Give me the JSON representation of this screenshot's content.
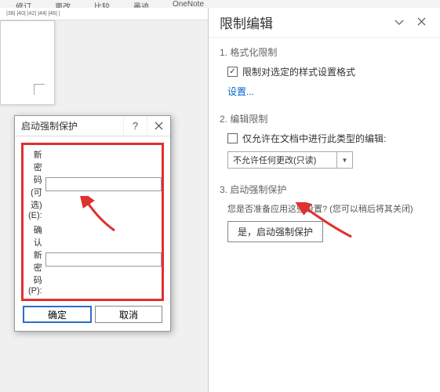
{
  "top_tabs": {
    "t1": "修订",
    "t2": "更改",
    "t3": "比较",
    "t4": "墨迹",
    "t5": "OneNote"
  },
  "ruler": {
    "marks": "|38|   |40|  |42|  |44|  |46|  |"
  },
  "dialog": {
    "title": "启动强制保护",
    "help": "?",
    "pwd1_label": "新密码(可选)(E):",
    "pwd2_label": "确认新密码(P):",
    "ok": "确定",
    "cancel": "取消"
  },
  "panel": {
    "title": "限制编辑",
    "section1": {
      "title": "1. 格式化限制",
      "check_label": "限制对选定的样式设置格式",
      "settings_link": "设置..."
    },
    "section2": {
      "title": "2. 编辑限制",
      "check_label": "仅允许在文档中进行此类型的编辑:",
      "dropdown": "不允许任何更改(只读)"
    },
    "section3": {
      "title": "3. 启动强制保护",
      "question": "您是否准备应用这些设置? (您可以稍后将其关闭)",
      "button": "是，启动强制保护"
    }
  }
}
